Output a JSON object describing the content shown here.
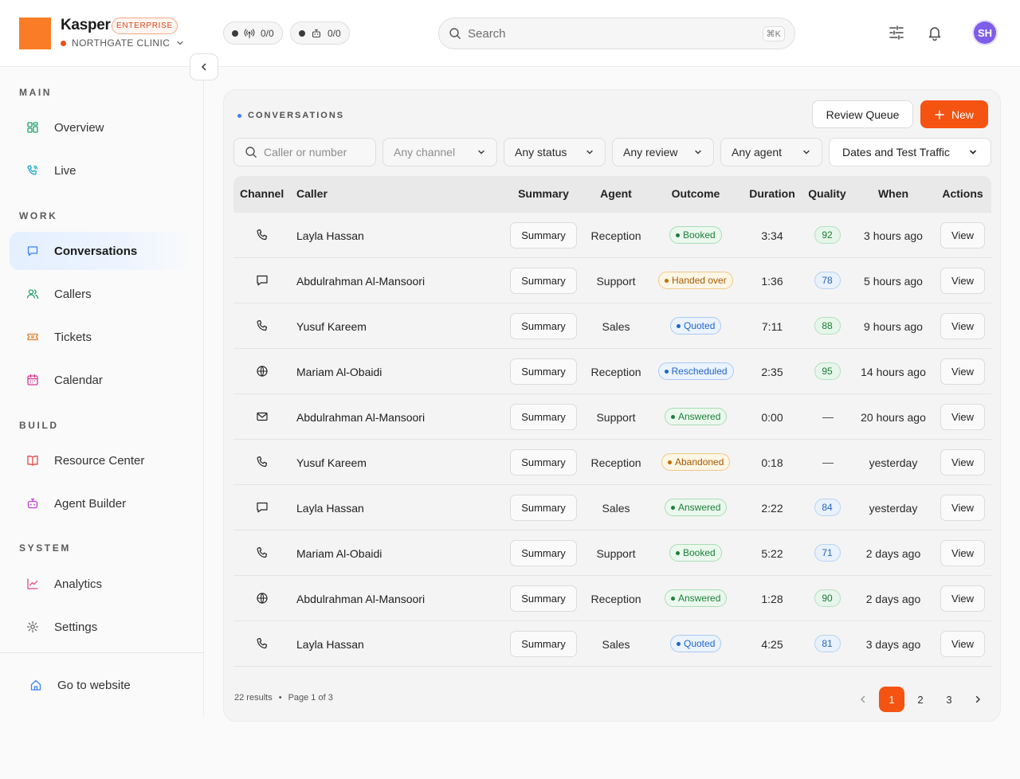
{
  "app": {
    "name": "Kasper",
    "plan_badge": "ENTERPRISE",
    "org": "NORTHGATE CLINIC",
    "brand_color": "#fb7c26"
  },
  "topbar": {
    "stats": [
      {
        "icon": "radio-tower-icon",
        "value": "0/0"
      },
      {
        "icon": "robot-icon",
        "value": "0/0"
      }
    ],
    "search_placeholder": "Search",
    "search_shortcut": "⌘K",
    "avatar_initials": "SH"
  },
  "sidebar": {
    "sections": [
      {
        "title": "MAIN",
        "items": [
          {
            "label": "Overview",
            "icon": "grid-icon"
          },
          {
            "label": "Live",
            "icon": "phone-live-icon"
          }
        ]
      },
      {
        "title": "WORK",
        "items": [
          {
            "label": "Conversations",
            "icon": "chat-icon",
            "active": true
          },
          {
            "label": "Callers",
            "icon": "users-icon"
          },
          {
            "label": "Tickets",
            "icon": "ticket-icon"
          },
          {
            "label": "Calendar",
            "icon": "calendar-icon"
          }
        ]
      },
      {
        "title": "BUILD",
        "items": [
          {
            "label": "Resource Center",
            "icon": "book-icon"
          },
          {
            "label": "Agent Builder",
            "icon": "robot-icon"
          }
        ]
      },
      {
        "title": "SYSTEM",
        "items": [
          {
            "label": "Analytics",
            "icon": "chart-icon"
          },
          {
            "label": "Settings",
            "icon": "gear-icon"
          }
        ]
      }
    ],
    "footer_link": "Go to website"
  },
  "conversations": {
    "title": "CONVERSATIONS",
    "review_queue_label": "Review Queue",
    "new_label": "New",
    "filters": {
      "search_placeholder": "Caller or number",
      "channel": "Any channel",
      "status": "Any status",
      "review": "Any review",
      "agent": "Any agent",
      "dates": "Dates and Test Traffic"
    },
    "columns": [
      "Channel",
      "Caller",
      "Summary",
      "Agent",
      "Outcome",
      "Duration",
      "Quality",
      "When",
      "Actions"
    ],
    "summary_label": "Summary",
    "view_label": "View",
    "rows": [
      {
        "channel": "phone",
        "caller": "Layla Hassan",
        "agent": "Reception",
        "outcome": "Booked",
        "outcome_tone": "green",
        "duration": "3:34",
        "quality": "92",
        "quality_tone": "g",
        "when": "3 hours ago"
      },
      {
        "channel": "chat",
        "caller": "Abdulrahman Al-Mansoori",
        "agent": "Support",
        "outcome": "Handed over",
        "outcome_tone": "amber",
        "duration": "1:36",
        "quality": "78",
        "quality_tone": "b",
        "when": "5 hours ago"
      },
      {
        "channel": "phone",
        "caller": "Yusuf Kareem",
        "agent": "Sales",
        "outcome": "Quoted",
        "outcome_tone": "blue",
        "duration": "7:11",
        "quality": "88",
        "quality_tone": "g",
        "when": "9 hours ago"
      },
      {
        "channel": "web",
        "caller": "Mariam Al-Obaidi",
        "agent": "Reception",
        "outcome": "Rescheduled",
        "outcome_tone": "blue",
        "duration": "2:35",
        "quality": "95",
        "quality_tone": "g",
        "when": "14 hours ago"
      },
      {
        "channel": "email",
        "caller": "Abdulrahman Al-Mansoori",
        "agent": "Support",
        "outcome": "Answered",
        "outcome_tone": "green",
        "duration": "0:00",
        "quality": "—",
        "quality_tone": "none",
        "when": "20 hours ago"
      },
      {
        "channel": "phone",
        "caller": "Yusuf Kareem",
        "agent": "Reception",
        "outcome": "Abandoned",
        "outcome_tone": "amber",
        "duration": "0:18",
        "quality": "—",
        "quality_tone": "none",
        "when": "yesterday"
      },
      {
        "channel": "chat",
        "caller": "Layla Hassan",
        "agent": "Sales",
        "outcome": "Answered",
        "outcome_tone": "green",
        "duration": "2:22",
        "quality": "84",
        "quality_tone": "b",
        "when": "yesterday"
      },
      {
        "channel": "phone",
        "caller": "Mariam Al-Obaidi",
        "agent": "Support",
        "outcome": "Booked",
        "outcome_tone": "green",
        "duration": "5:22",
        "quality": "71",
        "quality_tone": "b",
        "when": "2 days ago"
      },
      {
        "channel": "web",
        "caller": "Abdulrahman Al-Mansoori",
        "agent": "Reception",
        "outcome": "Answered",
        "outcome_tone": "green",
        "duration": "1:28",
        "quality": "90",
        "quality_tone": "g",
        "when": "2 days ago"
      },
      {
        "channel": "phone",
        "caller": "Layla Hassan",
        "agent": "Sales",
        "outcome": "Quoted",
        "outcome_tone": "blue",
        "duration": "4:25",
        "quality": "81",
        "quality_tone": "b",
        "when": "3 days ago"
      }
    ],
    "footer": {
      "results": "22 results",
      "page_info": "Page 1 of 3",
      "pages": [
        "1",
        "2",
        "3"
      ],
      "current_page": "1"
    }
  },
  "colors": {
    "accent": "#f55312",
    "active_nav": "#e4efff",
    "link_blue": "#3b82f6"
  }
}
